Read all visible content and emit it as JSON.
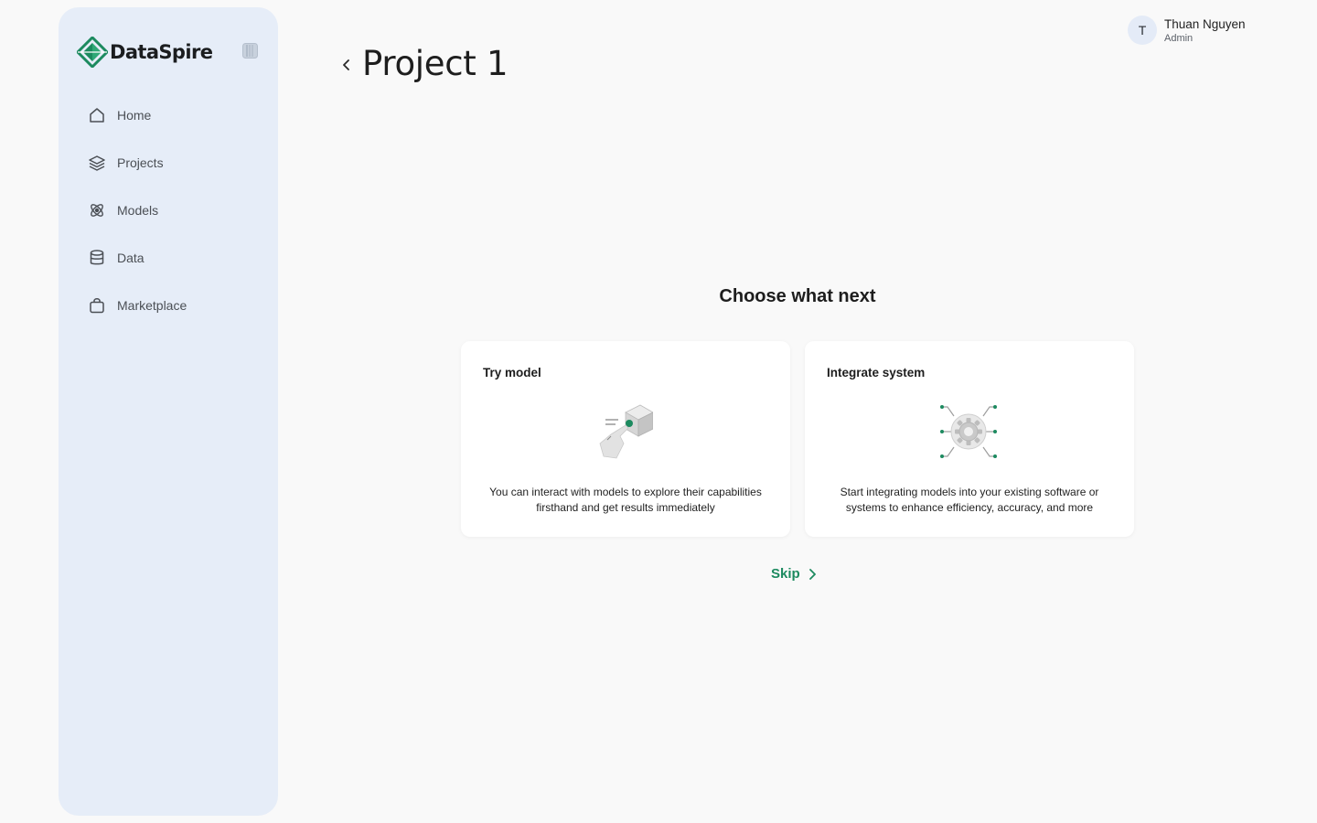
{
  "brand": {
    "name": "DataSpire",
    "accent_color": "#1c8a5f"
  },
  "sidebar": {
    "items": [
      {
        "label": "Home",
        "icon": "home-icon"
      },
      {
        "label": "Projects",
        "icon": "layers-icon"
      },
      {
        "label": "Models",
        "icon": "atom-icon"
      },
      {
        "label": "Data",
        "icon": "database-icon"
      },
      {
        "label": "Marketplace",
        "icon": "shopping-bag-icon"
      }
    ]
  },
  "header": {
    "title": "Project 1"
  },
  "user": {
    "initial": "T",
    "name": "Thuan Nguyen",
    "role": "Admin"
  },
  "main": {
    "heading": "Choose what next",
    "cards": [
      {
        "title": "Try model",
        "description": "You can interact with models to explore their capabilities firsthand and get results immediately",
        "icon": "try-model-illustration"
      },
      {
        "title": "Integrate system",
        "description": "Start integrating models into your existing software or systems to enhance efficiency, accuracy, and more",
        "icon": "integrate-system-illustration"
      }
    ],
    "skip_label": "Skip"
  }
}
